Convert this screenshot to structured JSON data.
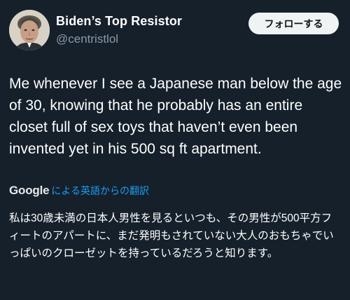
{
  "user": {
    "display_name": "Biden’s Top Resistor",
    "handle": "@centristlol",
    "avatar_icon": "portrait-avatar"
  },
  "follow_button": {
    "label": "フォローする"
  },
  "tweet": {
    "text": "Me whenever I see a Japanese man below the age of 30, knowing that he probably has an entire closet full of sex toys that haven’t even been invented yet in his 500 sq ft apartment."
  },
  "translation": {
    "provider": "Google",
    "link_label": "による英語からの翻訳",
    "text": "私は30歳未満の日本人男性を見るといつも、その男性が500平方フィートのアパートに、まだ発明もされていない大人のおもちゃでいっぱいのクローゼットを持っているだろうと知ります。"
  },
  "colors": {
    "background": "#15202b",
    "primary_text": "#ffffff",
    "secondary_text": "#8b98a5",
    "link": "#1d9bf0",
    "button_bg": "#eff3f4"
  }
}
